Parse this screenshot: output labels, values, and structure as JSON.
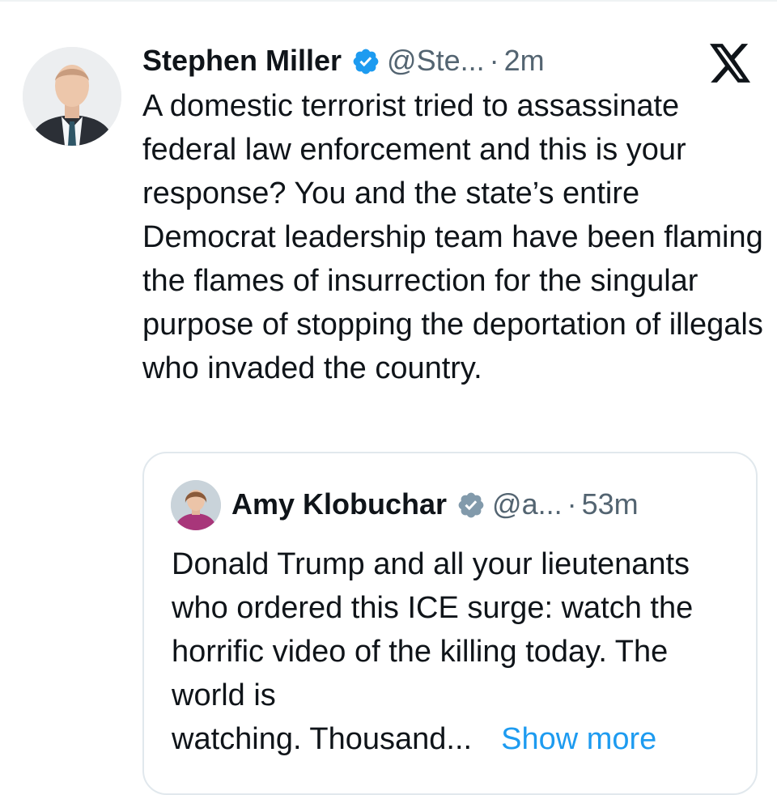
{
  "tweet": {
    "author_name": "Stephen Miller",
    "handle": "@Ste...",
    "separator": "·",
    "time": "2m",
    "text": "A domestic terrorist tried to assassinate federal law enforcement and this is your response? You and the state’s entire Democrat leadership team have been flaming the flames of insurrection for the singular purpose of stopping the deportation of illegals who invaded the country.",
    "verified_icon": "verified-badge-blue",
    "logo_icon": "x-logo"
  },
  "quote": {
    "author_name": "Amy Klobuchar",
    "handle": "@a...",
    "separator": "·",
    "time": "53m",
    "text": "Donald Trump and all your lieutenants who ordered this ICE surge: watch the horrific video of the killing today. The world is",
    "last_line": "watching. Thousand...",
    "show_more": "Show more",
    "verified_icon": "verified-badge-grey"
  },
  "colors": {
    "verified_blue": "#1d9bf0",
    "verified_grey": "#829aab",
    "secondary_text": "#536471",
    "link": "#1d9bf0"
  }
}
